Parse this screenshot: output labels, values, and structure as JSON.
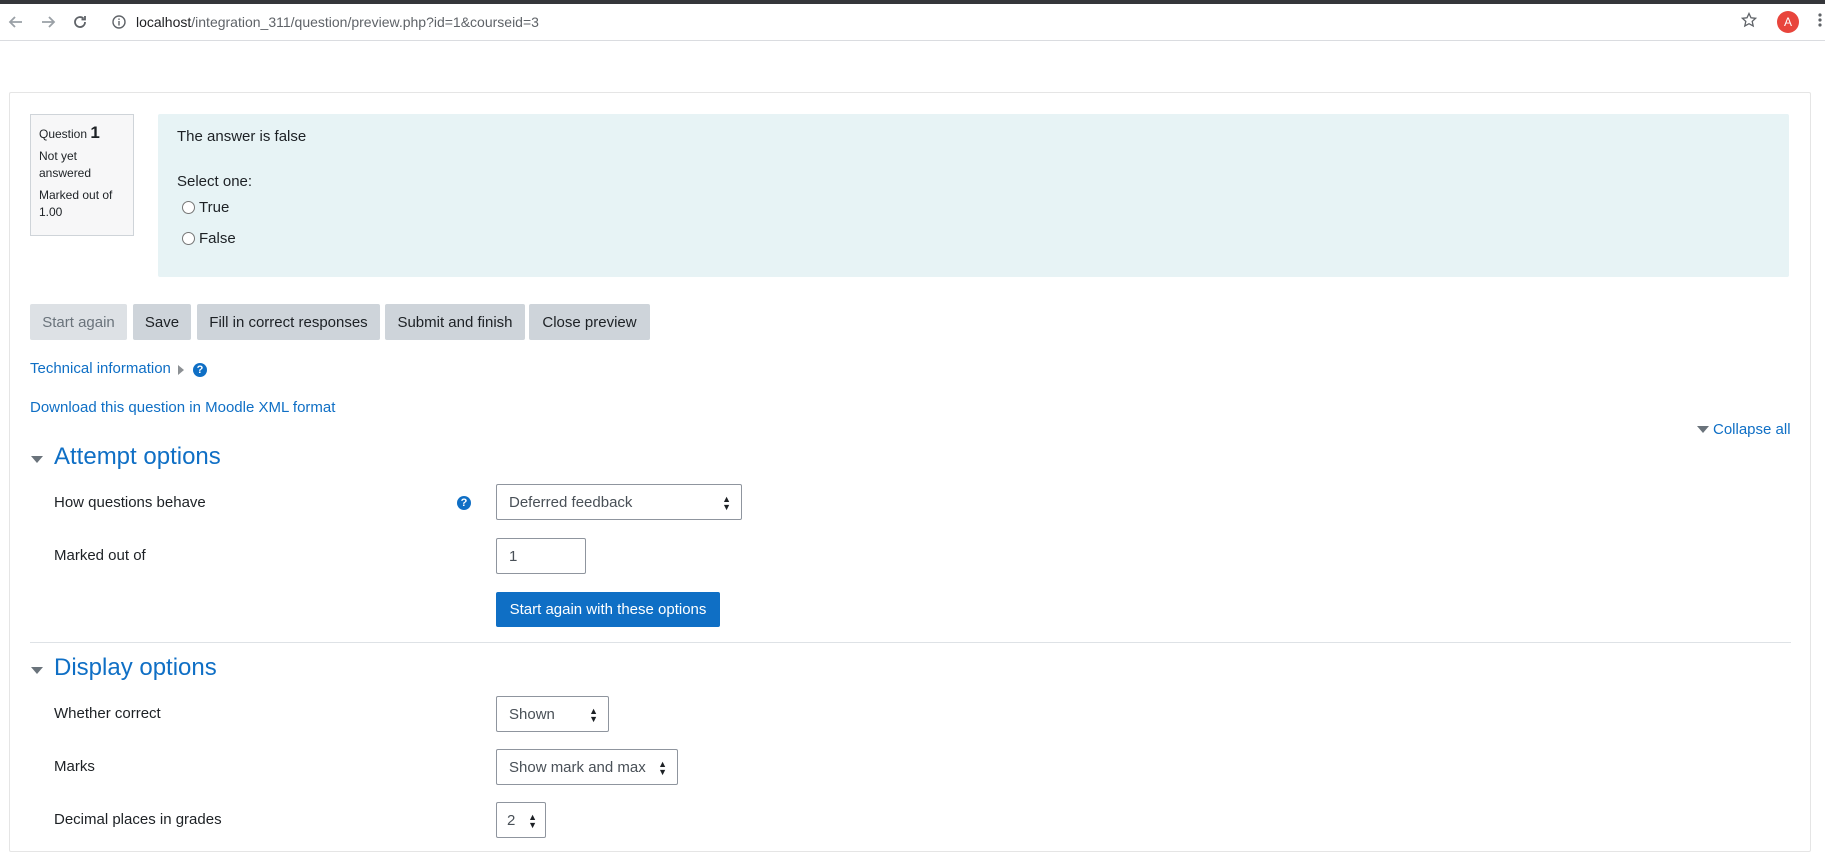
{
  "browser": {
    "url_host": "localhost",
    "url_path": "/integration_311/question/preview.php?id=1&courseid=3",
    "avatar_letter": "A"
  },
  "question_info": {
    "label": "Question",
    "number": "1",
    "state": "Not yet answered",
    "mark": "Marked out of 1.00"
  },
  "question": {
    "text": "The answer is false",
    "prompt": "Select one:",
    "options": [
      "True",
      "False"
    ]
  },
  "actions": {
    "start_again": "Start again",
    "save": "Save",
    "fill_correct": "Fill in correct responses",
    "submit_finish": "Submit and finish",
    "close_preview": "Close preview"
  },
  "links": {
    "technical_info": "Technical information",
    "download_xml": "Download this question in Moodle XML format",
    "collapse_all": "Collapse all"
  },
  "attempt_options": {
    "title": "Attempt options",
    "behaviour_label": "How questions behave",
    "behaviour_value": "Deferred feedback",
    "marked_out_label": "Marked out of",
    "marked_out_value": "1",
    "start_again_button": "Start again with these options"
  },
  "display_options": {
    "title": "Display options",
    "whether_correct_label": "Whether correct",
    "whether_correct_value": "Shown",
    "marks_label": "Marks",
    "marks_value": "Show mark and max",
    "decimal_label": "Decimal places in grades",
    "decimal_value": "2"
  },
  "colors": {
    "link": "#0f6fc5",
    "formulation_bg": "#e7f3f5",
    "button_bg": "#ced4da",
    "primary": "#0f6fc5"
  }
}
